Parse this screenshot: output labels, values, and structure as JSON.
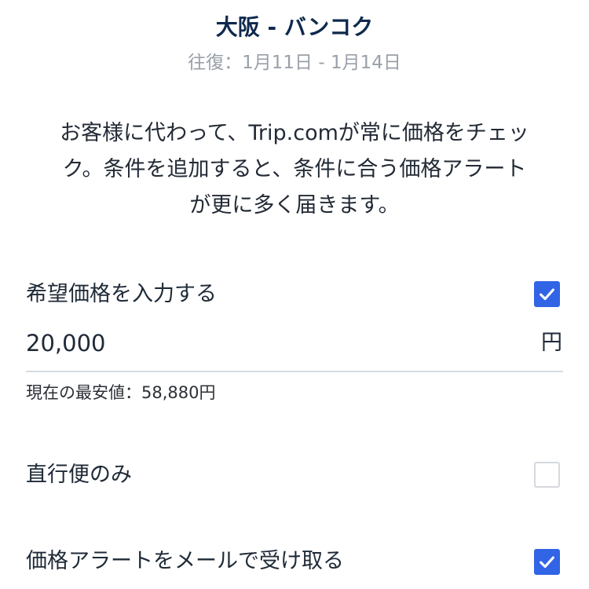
{
  "route": {
    "title": "大阪 - バンコク",
    "dates": "往復：1月11日 - 1月14日"
  },
  "description_lines": [
    "お客様に代わって、Trip.comが常に価格をチェッ",
    "ク。条件を追加すると、条件に合う価格アラート",
    "が更に多く届きます。"
  ],
  "target_price": {
    "label": "希望価格を入力する",
    "checked": true,
    "value": "20,000",
    "unit": "円",
    "lowest_price": "現在の最安値：58,880円"
  },
  "direct_only": {
    "label": "直行便のみ",
    "checked": false
  },
  "email_alert": {
    "label": "価格アラートをメールで受け取る",
    "checked": true
  },
  "colors": {
    "accent": "#3264e6",
    "title": "#0f294d",
    "subtitle": "#9aa0a8",
    "divider": "#d6dbe2"
  },
  "icons": {
    "checkbox_mark": "check-icon"
  }
}
